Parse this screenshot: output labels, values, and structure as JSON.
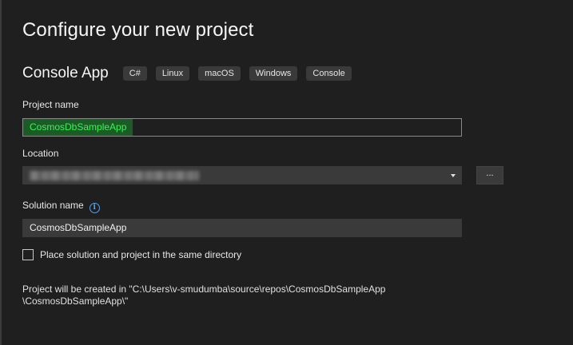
{
  "page": {
    "title": "Configure your new project"
  },
  "template": {
    "name": "Console App",
    "tags": [
      "C#",
      "Linux",
      "macOS",
      "Windows",
      "Console"
    ]
  },
  "project_name": {
    "label": "Project name",
    "value": "CosmosDbSampleApp"
  },
  "location": {
    "label": "Location",
    "browse_label": "..."
  },
  "solution_name": {
    "label": "Solution name",
    "value": "CosmosDbSampleApp",
    "info_icon": "info-icon"
  },
  "same_directory": {
    "label": "Place solution and project in the same directory",
    "checked": false
  },
  "summary": {
    "line1": "Project will be created in \"C:\\Users\\v-smudumba\\source\\repos\\CosmosDbSampleApp",
    "line2": "\\CosmosDbSampleApp\\\""
  },
  "colors": {
    "background": "#1f1f1f",
    "selection_highlight": "#1b5c26",
    "selection_text": "#3df05a",
    "info_accent": "#5aa0e6"
  }
}
